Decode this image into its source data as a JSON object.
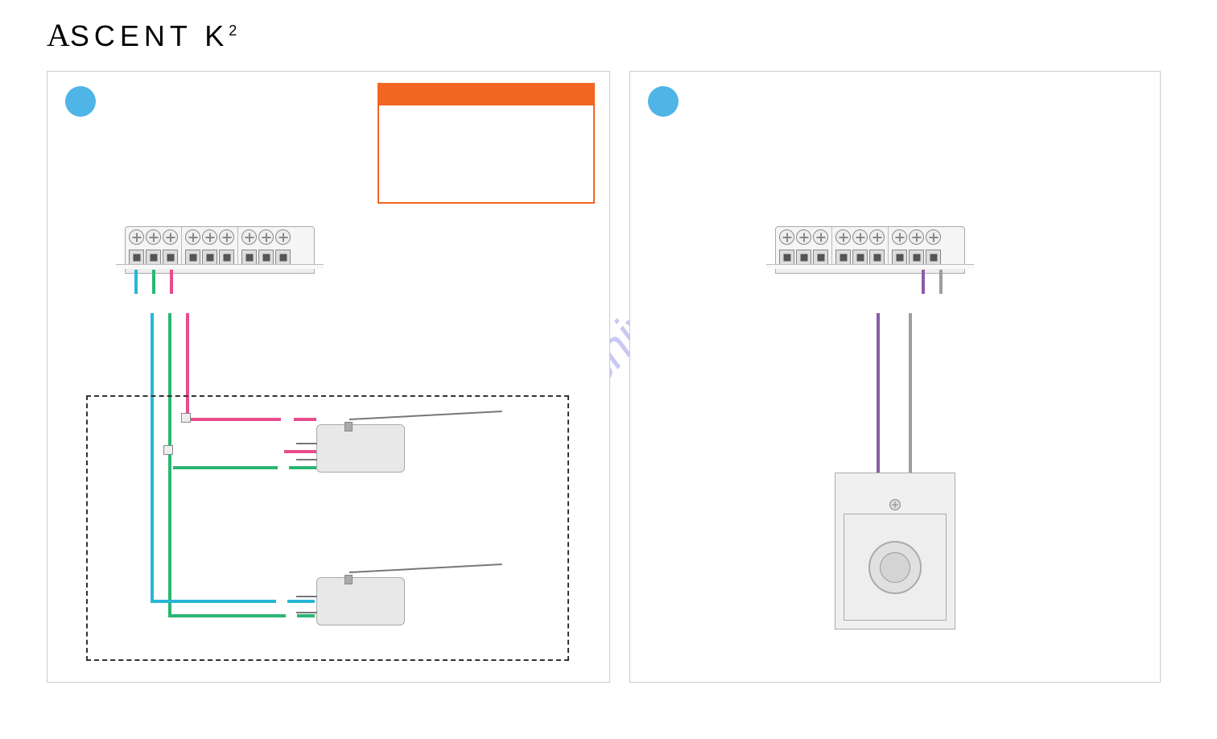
{
  "logo": {
    "brand_pre": "A",
    "brand_rest": "SCENT K",
    "superscript": "2"
  },
  "watermark": "manualshive.com",
  "left_panel": {
    "step_number": "",
    "warning_title": "",
    "terminal_groups": [
      3,
      3,
      3
    ],
    "wires_from_terminal": [
      {
        "index": 0,
        "color": "cyan"
      },
      {
        "index": 1,
        "color": "green"
      },
      {
        "index": 2,
        "color": "pink"
      }
    ],
    "switch_upper_wire_color": "pink",
    "switch_lower_wire_color": "cyan",
    "common_wire_color": "green"
  },
  "right_panel": {
    "step_number": "",
    "terminal_groups": [
      3,
      3,
      3
    ],
    "wires_from_terminal": [
      {
        "index": 7,
        "color": "purple"
      },
      {
        "index": 8,
        "color": "grey"
      }
    ],
    "device": "push-button"
  }
}
